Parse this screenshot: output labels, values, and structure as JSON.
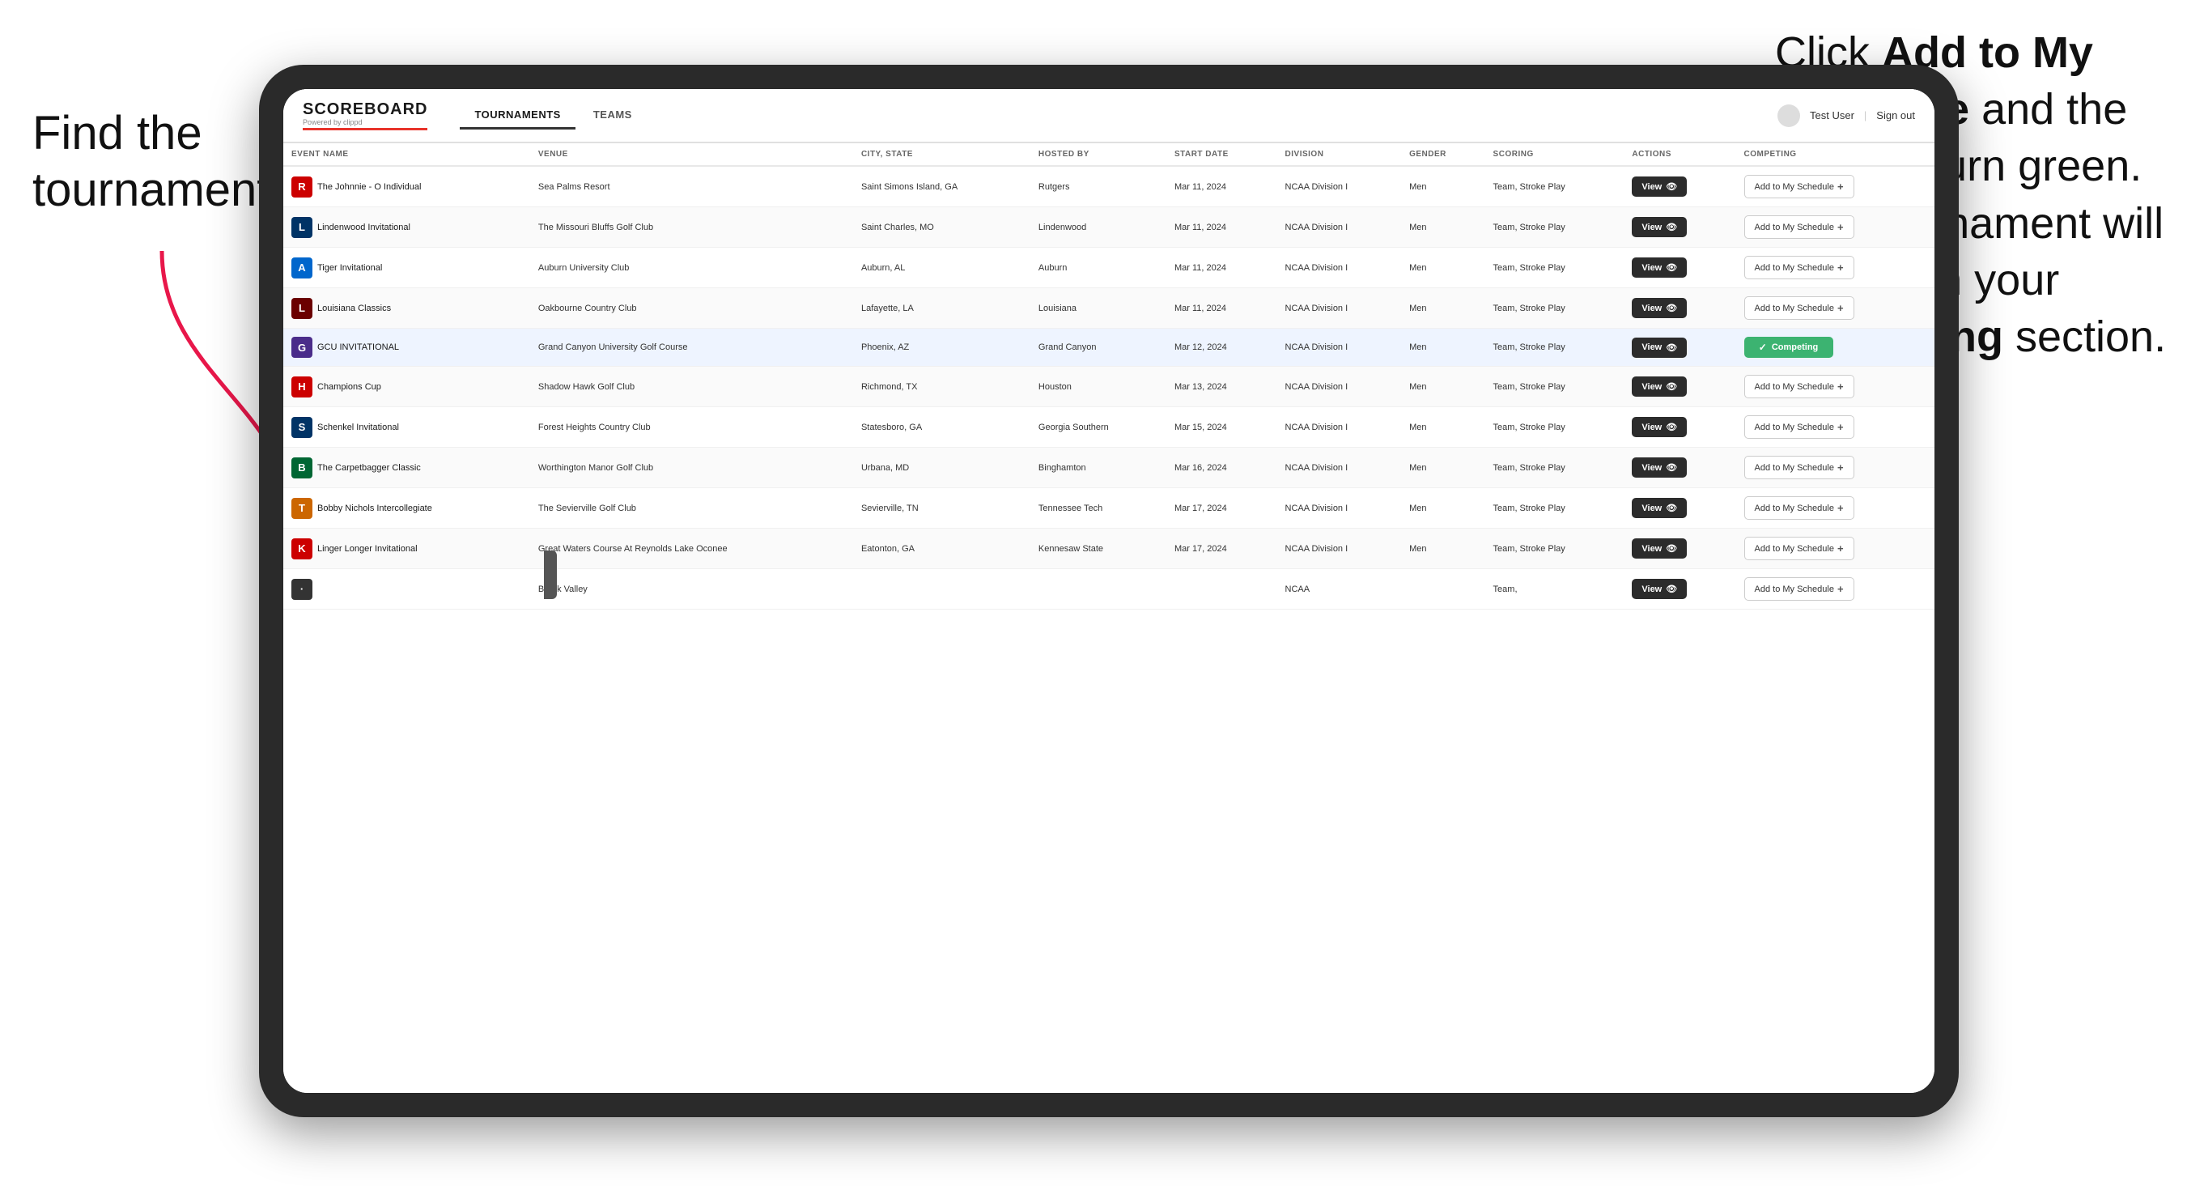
{
  "annotations": {
    "left": "Find the\ntournament.",
    "right_line1": "Click ",
    "right_bold1": "Add to My\nSchedule",
    "right_line2": " and the\nbox will turn green.\nThis tournament\nwill now be in\nyour ",
    "right_bold2": "Competing",
    "right_line3": "\nsection."
  },
  "header": {
    "logo": "SCOREBOARD",
    "logo_sub": "Powered by clippd",
    "nav_tabs": [
      {
        "label": "TOURNAMENTS",
        "active": true
      },
      {
        "label": "TEAMS",
        "active": false
      }
    ],
    "user_name": "Test User",
    "sign_out": "Sign out"
  },
  "table": {
    "columns": [
      "EVENT NAME",
      "VENUE",
      "CITY, STATE",
      "HOSTED BY",
      "START DATE",
      "DIVISION",
      "GENDER",
      "SCORING",
      "ACTIONS",
      "COMPETING"
    ],
    "rows": [
      {
        "logo": "🔴",
        "event_name": "The Johnnie - O Individual",
        "venue": "Sea Palms Resort",
        "city_state": "Saint Simons Island, GA",
        "hosted_by": "Rutgers",
        "start_date": "Mar 11, 2024",
        "division": "NCAA Division I",
        "gender": "Men",
        "scoring": "Team, Stroke Play",
        "competing": "add",
        "highlighted": false
      },
      {
        "logo": "🦁",
        "event_name": "Lindenwood Invitational",
        "venue": "The Missouri Bluffs Golf Club",
        "city_state": "Saint Charles, MO",
        "hosted_by": "Lindenwood",
        "start_date": "Mar 11, 2024",
        "division": "NCAA Division I",
        "gender": "Men",
        "scoring": "Team, Stroke Play",
        "competing": "add",
        "highlighted": false
      },
      {
        "logo": "🐯",
        "event_name": "Tiger Invitational",
        "venue": "Auburn University Club",
        "city_state": "Auburn, AL",
        "hosted_by": "Auburn",
        "start_date": "Mar 11, 2024",
        "division": "NCAA Division I",
        "gender": "Men",
        "scoring": "Team, Stroke Play",
        "competing": "add",
        "highlighted": false
      },
      {
        "logo": "⚜️",
        "event_name": "Louisiana Classics",
        "venue": "Oakbourne Country Club",
        "city_state": "Lafayette, LA",
        "hosted_by": "Louisiana",
        "start_date": "Mar 11, 2024",
        "division": "NCAA Division I",
        "gender": "Men",
        "scoring": "Team, Stroke Play",
        "competing": "add",
        "highlighted": false
      },
      {
        "logo": "🏔️",
        "event_name": "GCU INVITATIONAL",
        "venue": "Grand Canyon University Golf Course",
        "city_state": "Phoenix, AZ",
        "hosted_by": "Grand Canyon",
        "start_date": "Mar 12, 2024",
        "division": "NCAA Division I",
        "gender": "Men",
        "scoring": "Team, Stroke Play",
        "competing": "competing",
        "highlighted": true
      },
      {
        "logo": "🅗",
        "event_name": "Champions Cup",
        "venue": "Shadow Hawk Golf Club",
        "city_state": "Richmond, TX",
        "hosted_by": "Houston",
        "start_date": "Mar 13, 2024",
        "division": "NCAA Division I",
        "gender": "Men",
        "scoring": "Team, Stroke Play",
        "competing": "add",
        "highlighted": false
      },
      {
        "logo": "🐾",
        "event_name": "Schenkel Invitational",
        "venue": "Forest Heights Country Club",
        "city_state": "Statesboro, GA",
        "hosted_by": "Georgia Southern",
        "start_date": "Mar 15, 2024",
        "division": "NCAA Division I",
        "gender": "Men",
        "scoring": "Team, Stroke Play",
        "competing": "add",
        "highlighted": false
      },
      {
        "logo": "🅑",
        "event_name": "The Carpetbagger Classic",
        "venue": "Worthington Manor Golf Club",
        "city_state": "Urbana, MD",
        "hosted_by": "Binghamton",
        "start_date": "Mar 16, 2024",
        "division": "NCAA Division I",
        "gender": "Men",
        "scoring": "Team, Stroke Play",
        "competing": "add",
        "highlighted": false
      },
      {
        "logo": "🔶",
        "event_name": "Bobby Nichols Intercollegiate",
        "venue": "The Sevierville Golf Club",
        "city_state": "Sevierville, TN",
        "hosted_by": "Tennessee Tech",
        "start_date": "Mar 17, 2024",
        "division": "NCAA Division I",
        "gender": "Men",
        "scoring": "Team, Stroke Play",
        "competing": "add",
        "highlighted": false
      },
      {
        "logo": "🐻",
        "event_name": "Linger Longer Invitational",
        "venue": "Great Waters Course At Reynolds Lake Oconee",
        "city_state": "Eatonton, GA",
        "hosted_by": "Kennesaw State",
        "start_date": "Mar 17, 2024",
        "division": "NCAA Division I",
        "gender": "Men",
        "scoring": "Team, Stroke Play",
        "competing": "add",
        "highlighted": false
      },
      {
        "logo": "🌿",
        "event_name": "",
        "venue": "Brook Valley",
        "city_state": "",
        "hosted_by": "",
        "start_date": "",
        "division": "NCAA",
        "gender": "",
        "scoring": "Team,",
        "competing": "add",
        "highlighted": false
      }
    ],
    "view_label": "View",
    "add_label": "Add to My Schedule",
    "competing_label": "Competing"
  }
}
